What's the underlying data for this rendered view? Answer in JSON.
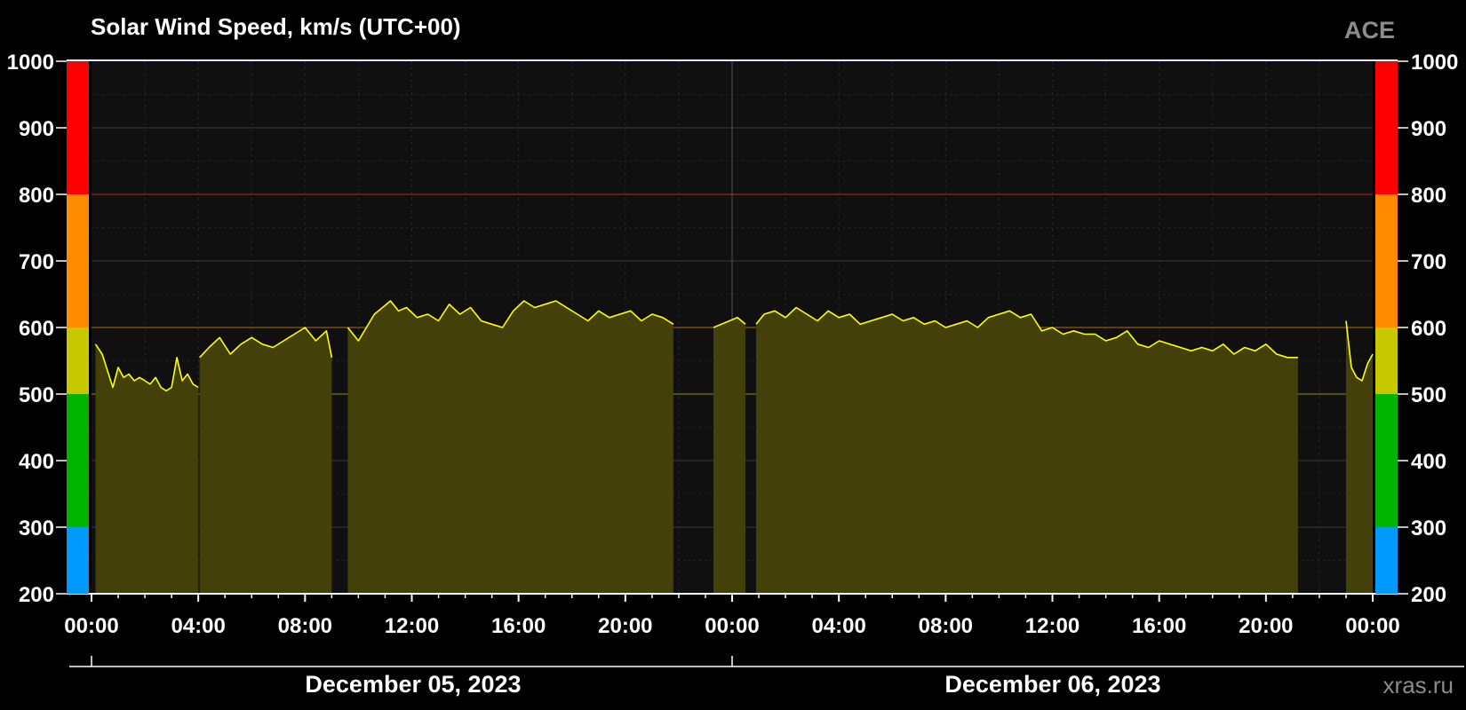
{
  "chart_data": {
    "type": "area",
    "title": "Solar Wind Speed, km/s (UTC+00)",
    "source_label": "ACE",
    "credit": "xras.ru",
    "ylim": [
      200,
      1000
    ],
    "y_ticks": [
      "200",
      "300",
      "400",
      "500",
      "600",
      "700",
      "800",
      "900",
      "1000"
    ],
    "x_range_hours": [
      0,
      48
    ],
    "x_ticks": [
      "00:00",
      "04:00",
      "08:00",
      "12:00",
      "16:00",
      "20:00",
      "00:00",
      "04:00",
      "08:00",
      "12:00",
      "16:00",
      "20:00",
      "00:00"
    ],
    "dates": [
      "December 05, 2023",
      "December 06, 2023"
    ],
    "grid": true,
    "threshold_lines": [
      {
        "value": 500,
        "color": "#c8c800"
      },
      {
        "value": 600,
        "color": "#ff8c00"
      },
      {
        "value": 800,
        "color": "#ff2a00"
      }
    ],
    "color_scale": [
      {
        "from": 200,
        "to": 300,
        "color": "#0099ff"
      },
      {
        "from": 300,
        "to": 500,
        "color": "#00b400"
      },
      {
        "from": 500,
        "to": 600,
        "color": "#c8c800"
      },
      {
        "from": 600,
        "to": 800,
        "color": "#ff8c00"
      },
      {
        "from": 800,
        "to": 1000,
        "color": "#ff0000"
      }
    ],
    "colors": {
      "line": "#ffff00",
      "fill": "#44400a",
      "plot_bg": "#101010"
    },
    "series": [
      {
        "x": [
          0.15,
          0.4,
          0.6,
          0.8,
          1.0,
          1.2,
          1.4,
          1.6,
          1.8,
          2.0,
          2.2,
          2.4,
          2.6,
          2.8,
          3.0,
          3.2,
          3.4,
          3.6,
          3.8,
          4.0
        ],
        "y": [
          575,
          560,
          535,
          510,
          540,
          525,
          530,
          520,
          525,
          520,
          515,
          525,
          510,
          505,
          510,
          555,
          520,
          530,
          515,
          510
        ]
      },
      {
        "x": [
          4.05,
          4.4,
          4.8,
          5.2,
          5.6,
          6.0,
          6.4,
          6.8,
          7.2,
          7.6,
          8.0,
          8.4,
          8.8,
          9.0
        ],
        "y": [
          555,
          570,
          585,
          560,
          575,
          585,
          575,
          570,
          580,
          590,
          600,
          580,
          595,
          555
        ]
      },
      {
        "x": [
          9.6,
          9.8,
          10.0,
          10.3,
          10.6,
          10.9,
          11.2,
          11.5,
          11.8,
          12.2,
          12.6,
          13.0,
          13.4,
          13.8,
          14.2,
          14.6,
          15.0,
          15.4,
          15.8,
          16.2,
          16.6,
          17.0,
          17.4,
          17.8,
          18.2,
          18.6,
          19.0,
          19.4,
          19.8,
          20.2,
          20.6,
          21.0,
          21.4,
          21.8
        ],
        "y": [
          600,
          590,
          580,
          600,
          620,
          630,
          640,
          625,
          630,
          615,
          620,
          610,
          635,
          620,
          630,
          610,
          605,
          600,
          625,
          640,
          630,
          635,
          640,
          630,
          620,
          610,
          625,
          615,
          620,
          625,
          610,
          620,
          615,
          605
        ]
      },
      {
        "x": [
          23.3,
          23.6,
          23.9,
          24.2,
          24.5
        ],
        "y": [
          600,
          605,
          610,
          615,
          605
        ]
      },
      {
        "x": [
          24.9,
          25.2,
          25.6,
          26.0,
          26.4,
          26.8,
          27.2,
          27.6,
          28.0,
          28.4,
          28.8,
          29.2,
          29.6,
          30.0,
          30.4,
          30.8,
          31.2,
          31.6,
          32.0,
          32.4,
          32.8,
          33.2,
          33.6,
          34.0,
          34.4,
          34.8,
          35.2,
          35.6,
          36.0,
          36.4,
          36.8,
          37.2,
          37.6,
          38.0,
          38.4,
          38.8,
          39.2,
          39.6,
          40.0,
          40.4,
          40.8,
          41.2,
          41.6,
          42.0,
          42.4,
          42.8,
          43.2,
          43.6,
          44.0,
          44.4,
          44.8,
          45.2
        ],
        "y": [
          605,
          620,
          625,
          615,
          630,
          620,
          610,
          625,
          615,
          620,
          605,
          610,
          615,
          620,
          610,
          615,
          605,
          610,
          600,
          605,
          610,
          600,
          615,
          620,
          625,
          615,
          620,
          595,
          600,
          590,
          595,
          590,
          590,
          580,
          585,
          595,
          575,
          570,
          580,
          575,
          570,
          565,
          570,
          565,
          575,
          560,
          570,
          565,
          575,
          560,
          555,
          555
        ]
      },
      {
        "x": [
          47.0,
          47.2,
          47.4,
          47.6,
          47.8,
          48.0
        ],
        "y": [
          610,
          540,
          525,
          520,
          545,
          560
        ]
      }
    ]
  }
}
